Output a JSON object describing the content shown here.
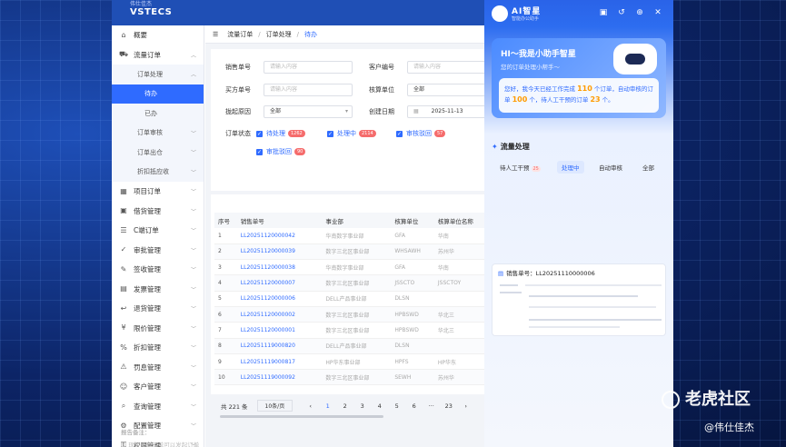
{
  "brand": {
    "logo_top": "伟仕佳杰",
    "logo_name": "VSTECS"
  },
  "sidebar": {
    "items": [
      {
        "label": "概要",
        "icon": "home-icon"
      },
      {
        "label": "流量订单",
        "icon": "cart-icon",
        "expanded": true
      },
      {
        "label": "项目订单",
        "icon": "grid-icon"
      },
      {
        "label": "借货管理",
        "icon": "box-icon"
      },
      {
        "label": "C端订单",
        "icon": "list-icon"
      },
      {
        "label": "审批管理",
        "icon": "check-icon"
      },
      {
        "label": "签收管理",
        "icon": "sign-icon"
      },
      {
        "label": "发票管理",
        "icon": "invoice-icon"
      },
      {
        "label": "退货管理",
        "icon": "return-icon"
      },
      {
        "label": "限价管理",
        "icon": "price-icon"
      },
      {
        "label": "折扣管理",
        "icon": "discount-icon"
      },
      {
        "label": "罚息管理",
        "icon": "penalty-icon"
      },
      {
        "label": "客户管理",
        "icon": "user-icon"
      },
      {
        "label": "查询管理",
        "icon": "search-icon"
      },
      {
        "label": "配置管理",
        "icon": "settings-icon"
      },
      {
        "label": "权限管理",
        "icon": "lock-icon"
      }
    ],
    "sub": {
      "label": "订单处理",
      "leaf": [
        "待办",
        "已办"
      ]
    },
    "sub_rest": [
      "订单审核",
      "订单出仓",
      "折扣抵应收"
    ]
  },
  "breadcrumb": [
    "流量订单",
    "订单处理",
    "待办"
  ],
  "filters": {
    "sales_no": {
      "label": "销售单号",
      "placeholder": "请输入内容"
    },
    "customer_no": {
      "label": "客户编号",
      "placeholder": "请输入内容"
    },
    "buyer_no": {
      "label": "买方单号",
      "placeholder": "请输入内容"
    },
    "settle_unit": {
      "label": "核算单位",
      "value": "全部"
    },
    "reject_reason": {
      "label": "拢起原因",
      "value": "全部"
    },
    "created_date": {
      "label": "创建日期",
      "value": "2025-11-13"
    },
    "status_label": "订单状态",
    "statuses": [
      {
        "label": "待处理",
        "count": "1262"
      },
      {
        "label": "处理中",
        "count": "2114"
      },
      {
        "label": "审核驳回",
        "count": "57"
      },
      {
        "label": "审批驳回",
        "count": "90"
      }
    ]
  },
  "table": {
    "columns": [
      "序号",
      "销售单号",
      "事业部",
      "核算单位",
      "核算单位名称",
      "客"
    ],
    "rows": [
      [
        "1",
        "LL20251120000042",
        "华南数字事业部",
        "GFA",
        "华南",
        "上"
      ],
      [
        "2",
        "LL20251120000039",
        "数字三北区事业部",
        "WHSAWH",
        "苏州华",
        "苏"
      ],
      [
        "3",
        "LL20251120000038",
        "华南数字事业部",
        "GFA",
        "华南",
        "上"
      ],
      [
        "4",
        "LL20251120000007",
        "数字三北区事业部",
        "JSSCTO",
        "JSSCTOY",
        "上"
      ],
      [
        "5",
        "LL20251120000006",
        "DELL产品事业部",
        "DLSN",
        "",
        "上"
      ],
      [
        "6",
        "LL20251120000002",
        "数字三北区事业部",
        "HPBSWD",
        "华北三",
        "苏"
      ],
      [
        "7",
        "LL20251120000001",
        "数字三北区事业部",
        "HPBSWD",
        "华北三",
        "苏"
      ],
      [
        "8",
        "LL20251119000820",
        "DELL产品事业部",
        "DLSN",
        "",
        "上"
      ],
      [
        "9",
        "LL20251119000817",
        "HP华东事业部",
        "HPFS",
        "HP华东",
        "上"
      ],
      [
        "10",
        "LL20251119000092",
        "数字三北区事业部",
        "SEWH",
        "苏州华",
        "苏"
      ]
    ]
  },
  "pager": {
    "total": "共 221 条",
    "size": "10条/页",
    "pages": [
      "1",
      "2",
      "3",
      "4",
      "5",
      "6",
      "···",
      "23"
    ],
    "current": "1"
  },
  "notes": {
    "label": "报告备注：",
    "line1": "1. 现金处理订单可以发起订单"
  },
  "ai": {
    "title": "AI智星",
    "subtitle": "智能办公助手",
    "greet": "HI～我是小助手智星",
    "greet_sub": "您的订单处理小帮手～",
    "msg_prefix": "您好，我今天已经工作完成",
    "done_count": "110",
    "msg_mid": "个订单，自动审核的订单",
    "auto_count": "100",
    "msg_mid2": "个，待人工干预的订单",
    "manual_count": "23",
    "msg_suffix": "个。",
    "section": "流量处理",
    "tabs": [
      {
        "label": "待人工干预",
        "count": "25"
      },
      {
        "label": "处理中",
        "count": ""
      },
      {
        "label": "自动审核",
        "count": ""
      },
      {
        "label": "全部",
        "count": ""
      }
    ],
    "preview_title": "销售单号：LL20251110000006"
  },
  "watermark": {
    "text": "老虎社区",
    "author": "@伟仕佳杰"
  }
}
